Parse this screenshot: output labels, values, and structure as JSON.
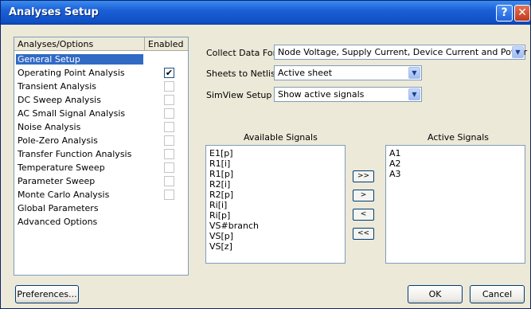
{
  "window": {
    "title": "Analyses Setup",
    "help_glyph": "?",
    "close_glyph": "✕"
  },
  "options": {
    "col_name": "Analyses/Options",
    "col_enabled": "Enabled",
    "items": [
      {
        "label": "General Setup",
        "selected": true,
        "checkbox": false
      },
      {
        "label": "Operating Point Analysis",
        "checkbox": true,
        "checked": true
      },
      {
        "label": "Transient Analysis",
        "checkbox": true,
        "checked": false
      },
      {
        "label": "DC Sweep Analysis",
        "checkbox": true,
        "checked": false
      },
      {
        "label": "AC Small Signal Analysis",
        "checkbox": true,
        "checked": false
      },
      {
        "label": "Noise Analysis",
        "checkbox": true,
        "checked": false
      },
      {
        "label": "Pole-Zero Analysis",
        "checkbox": true,
        "checked": false
      },
      {
        "label": "Transfer Function Analysis",
        "checkbox": true,
        "checked": false
      },
      {
        "label": "Temperature Sweep",
        "checkbox": true,
        "checked": false
      },
      {
        "label": "Parameter Sweep",
        "checkbox": true,
        "checked": false
      },
      {
        "label": "Monte Carlo Analysis",
        "checkbox": true,
        "checked": false
      },
      {
        "label": "Global Parameters",
        "checkbox": false
      },
      {
        "label": "Advanced Options",
        "checkbox": false
      }
    ]
  },
  "settings": {
    "collect_label": "Collect Data For",
    "collect_value": "Node Voltage, Supply Current, Device Current and Power",
    "sheets_label": "Sheets to Netlist",
    "sheets_value": "Active sheet",
    "simview_label": "SimView Setup",
    "simview_value": "Show active signals"
  },
  "signals": {
    "available_label": "Available Signals",
    "active_label": "Active Signals",
    "available": [
      "E1[p]",
      "R1[i]",
      "R1[p]",
      "R2[i]",
      "R2[p]",
      "Ri[i]",
      "Ri[p]",
      "VS#branch",
      "VS[p]",
      "VS[z]"
    ],
    "active": [
      "A1",
      "A2",
      "A3"
    ],
    "buttons": [
      ">>",
      ">",
      "<",
      "<<"
    ]
  },
  "footer": {
    "preferences": "Preferences...",
    "ok": "OK",
    "cancel": "Cancel"
  },
  "colors": {
    "title_bar": "#1b5fd6",
    "selection": "#316ac5",
    "dialog_bg": "#ece9d8"
  }
}
